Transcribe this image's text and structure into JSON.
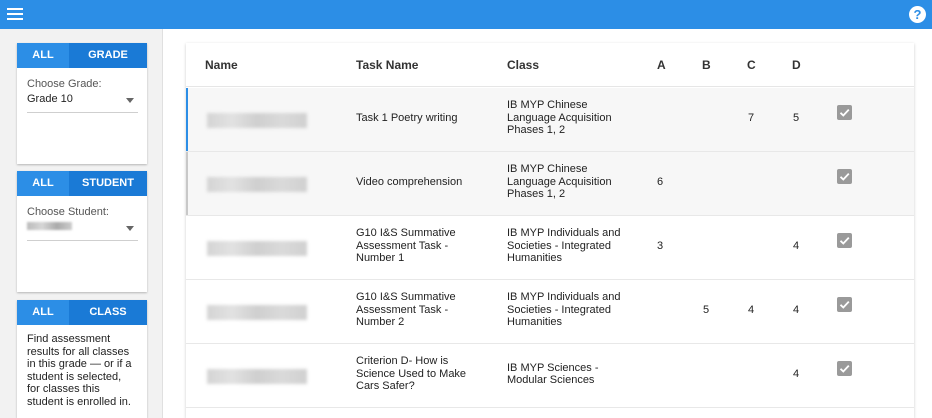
{
  "topbar": {
    "menu_icon": "menu-icon",
    "help_icon": "help-icon",
    "help_glyph": "?",
    "color": "#2c8ee6"
  },
  "filters": {
    "grade": {
      "tab_all": "ALL",
      "tab_selected": "GRADE",
      "label": "Choose Grade:",
      "value": "Grade 10"
    },
    "student": {
      "tab_all": "ALL",
      "tab_selected": "STUDENT",
      "label": "Choose Student:"
    },
    "class": {
      "tab_all": "ALL",
      "tab_selected": "CLASS",
      "description": "Find assessment results for all classes in this grade — or if a student is selected, for classes this student is enrolled in."
    }
  },
  "table": {
    "headers": {
      "name": "Name",
      "task_name": "Task Name",
      "class": "Class",
      "a": "A",
      "b": "B",
      "c": "C",
      "d": "D"
    },
    "rows": [
      {
        "task": [
          "Task 1 Poetry writing"
        ],
        "class": [
          "IB MYP Chinese",
          "Language Acquisition",
          "Phases 1, 2"
        ],
        "a": "",
        "b": "",
        "c": "7",
        "d": "5",
        "checked": true,
        "accent": "#2c8ee6"
      },
      {
        "task": [
          "Video comprehension"
        ],
        "class": [
          "IB MYP Chinese",
          "Language Acquisition",
          "Phases 1, 2"
        ],
        "a": "6",
        "b": "",
        "c": "",
        "d": "",
        "checked": true,
        "accent": "#c8c8c8"
      },
      {
        "task": [
          "G10 I&S Summative",
          "Assessment Task -",
          "Number 1"
        ],
        "class": [
          "IB MYP Individuals and",
          "Societies - Integrated",
          "Humanities"
        ],
        "a": "3",
        "b": "",
        "c": "",
        "d": "4",
        "checked": true,
        "accent": ""
      },
      {
        "task": [
          "G10 I&S Summative",
          "Assessment Task -",
          "Number 2"
        ],
        "class": [
          "IB MYP Individuals and",
          "Societies - Integrated",
          "Humanities"
        ],
        "a": "",
        "b": "5",
        "c": "4",
        "d": "4",
        "checked": true,
        "accent": ""
      },
      {
        "task": [
          "Criterion D- How is",
          "Science Used to Make",
          "Cars Safer?"
        ],
        "class": [
          "IB MYP Sciences -",
          "Modular Sciences"
        ],
        "a": "",
        "b": "",
        "c": "",
        "d": "4",
        "checked": true,
        "accent": ""
      }
    ]
  }
}
